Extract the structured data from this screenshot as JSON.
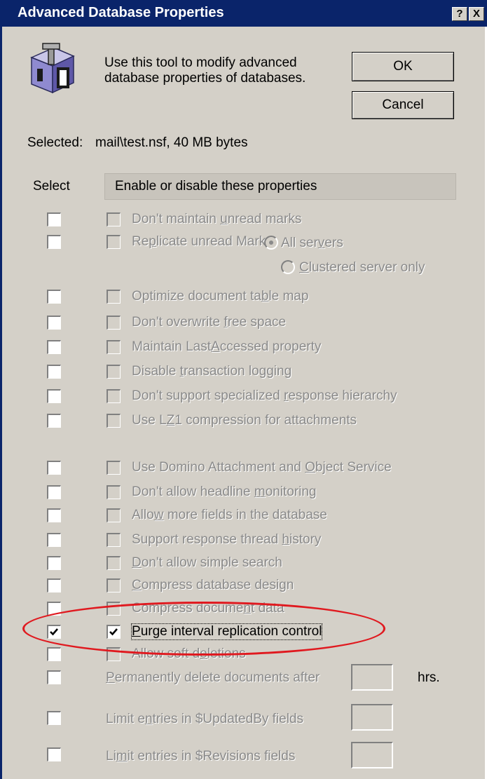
{
  "window": {
    "title": "Advanced Database Properties",
    "help_label": "?",
    "close_label": "X"
  },
  "intro": {
    "line1": "Use this tool to modify advanced",
    "line2": "database properties of databases.",
    "icon": "database-tool-icon"
  },
  "buttons": {
    "ok": "OK",
    "cancel": "Cancel"
  },
  "selected": {
    "label": "Selected:",
    "value": "mail\\test.nsf, 40 MB bytes"
  },
  "columns": {
    "select": "Select",
    "properties": "Enable or disable these properties"
  },
  "properties": [
    {
      "pre": "Don't maintain ",
      "key": "u",
      "post": "nread marks",
      "select": false,
      "checked": false
    },
    {
      "pre": "Re",
      "key": "p",
      "post": "licate unread Marks",
      "select": false,
      "checked": false
    },
    {
      "pre": "Optimize document ta",
      "key": "b",
      "post": "le map",
      "select": false,
      "checked": false
    },
    {
      "pre": "Don't overwrite ",
      "key": "f",
      "post": "ree space",
      "select": false,
      "checked": false
    },
    {
      "pre": "Maintain Last",
      "key": "A",
      "post": "ccessed property",
      "select": false,
      "checked": false
    },
    {
      "pre": "Disable ",
      "key": "t",
      "post": "ransaction logging",
      "select": false,
      "checked": false
    },
    {
      "pre": "Don't support specialized ",
      "key": "r",
      "post": "esponse hierarchy",
      "select": false,
      "checked": false
    },
    {
      "pre": "Use L",
      "key": "Z",
      "post": "1 compression for attachments",
      "select": false,
      "checked": false
    },
    {
      "pre": "Use Domino Attachment and ",
      "key": "O",
      "post": "bject Service",
      "select": false,
      "checked": false
    },
    {
      "pre": "Don't allow headline ",
      "key": "m",
      "post": "onitoring",
      "select": false,
      "checked": false
    },
    {
      "pre": "Allo",
      "key": "w",
      "post": " more fields in the database",
      "select": false,
      "checked": false
    },
    {
      "pre": "Support response thread ",
      "key": "h",
      "post": "istory",
      "select": false,
      "checked": false
    },
    {
      "pre": "",
      "key": "D",
      "post": "on't allow simple search",
      "select": false,
      "checked": false
    },
    {
      "pre": "",
      "key": "C",
      "post": "ompress database design",
      "select": false,
      "checked": false
    },
    {
      "pre": "Compress docume",
      "key": "n",
      "post": "t data",
      "select": false,
      "checked": false
    },
    {
      "pre": "",
      "key": "P",
      "post": "urge interval replication control",
      "select": true,
      "checked": true
    },
    {
      "pre": "Allow soft d",
      "key": "e",
      "post": "letions",
      "select": false,
      "checked": false
    }
  ],
  "replicate_options": {
    "all_servers": {
      "pre": "All ser",
      "key": "v",
      "post": "ers",
      "selected": true
    },
    "clustered": {
      "pre": "",
      "key": "C",
      "post": "lustered server only",
      "selected": false
    }
  },
  "settings": [
    {
      "pre": "",
      "key": "P",
      "post": "ermanently delete documents after",
      "value": "",
      "unit": "hrs."
    },
    {
      "pre": "Limit e",
      "key": "n",
      "post": "tries in $UpdatedBy fields",
      "value": "",
      "unit": ""
    },
    {
      "pre": "Li",
      "key": "m",
      "post": "it entries in $Revisions fields",
      "value": "",
      "unit": ""
    }
  ],
  "colors": {
    "titlebar": "#0a246a",
    "dialog": "#d4d0c8",
    "highlight_ellipse": "#e0191f",
    "disabled_text": "#8a8a8a"
  }
}
